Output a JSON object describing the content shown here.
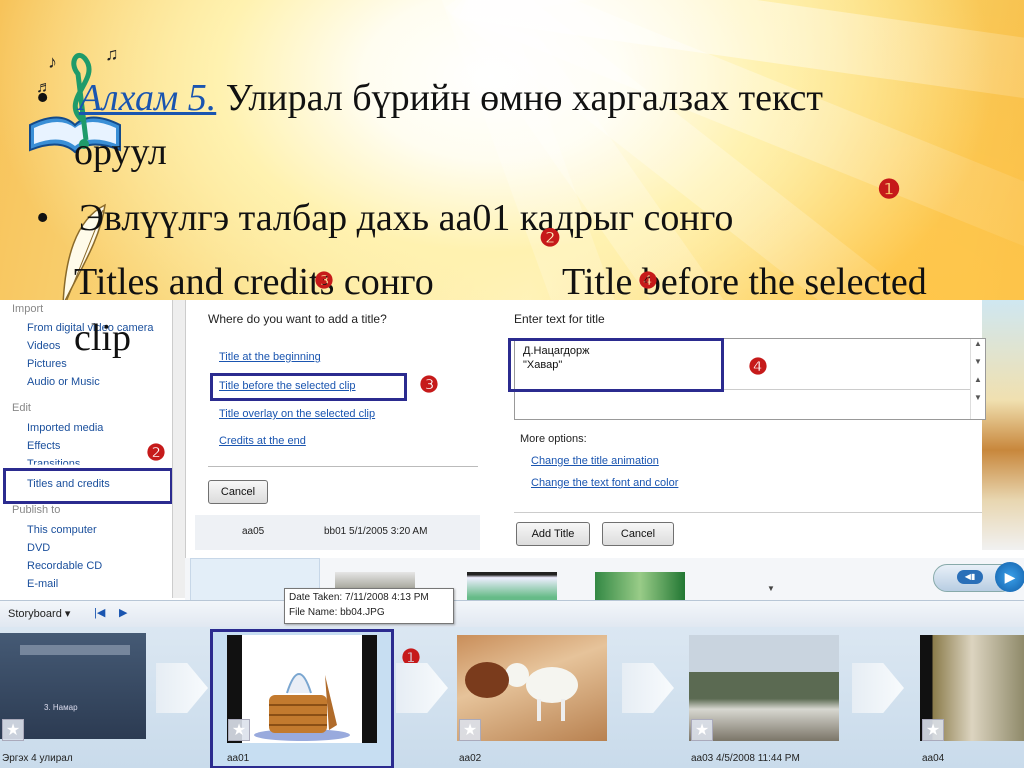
{
  "slide": {
    "step_label": "Алхам 5.",
    "line1_rest": " Улирал бүрийн өмнө харгалзах текст",
    "line1_cont": "оруул",
    "line2": "Эвлүүлгэ талбар дахь аа01 кадрыг сонго",
    "line3a": "Titles and credits сонго",
    "line3b": "Title before the selected",
    "line3c": "clip",
    "bullet": "•",
    "marker_1": "❶",
    "marker_2": "❷",
    "marker_3": "❸",
    "marker_4": "❹"
  },
  "sidebar": {
    "import_head": "Import",
    "import_items": [
      "From digital video camera",
      "Videos",
      "Pictures",
      "Audio or Music"
    ],
    "edit_head": "Edit",
    "edit_items": [
      "Imported media",
      "Effects",
      "Transitions",
      "Titles and credits"
    ],
    "publish_head": "Publish to",
    "publish_items": [
      "This computer",
      "DVD",
      "Recordable CD",
      "E-mail"
    ]
  },
  "title_panel": {
    "question": "Where do you want to add a title?",
    "options": [
      "Title at the beginning",
      "Title before the selected clip",
      "Title overlay on the selected clip",
      "Credits at the end"
    ],
    "cancel": "Cancel",
    "clip_names": [
      "aa05",
      "bb01 5/1/2005 3:20 AM"
    ]
  },
  "text_panel": {
    "label": "Enter text for title",
    "text_line1": "Д.Нацагдорж",
    "text_line2": "\"Хавар\"",
    "more_options": "More options:",
    "links": [
      "Change the title animation",
      "Change the text font and color"
    ],
    "add_title": "Add Title",
    "cancel": "Cancel"
  },
  "tooltip": {
    "date": "Date Taken: 7/11/2008 4:13 PM",
    "file": "File Name: bb04.JPG"
  },
  "storyboard": {
    "label": "Storyboard",
    "title_clip_top": "Эргэх 4 улирал",
    "title_clip_sub": "3. Намар",
    "captions": [
      "Эргэх 4 улирал",
      "aa01",
      "aa02",
      "aa03 4/5/2008 11:44 PM",
      "aa04"
    ]
  },
  "colors": {
    "accent_red": "#cc1d1d",
    "highlight_box": "#2b2b8f",
    "link_blue": "#1a55b0"
  }
}
